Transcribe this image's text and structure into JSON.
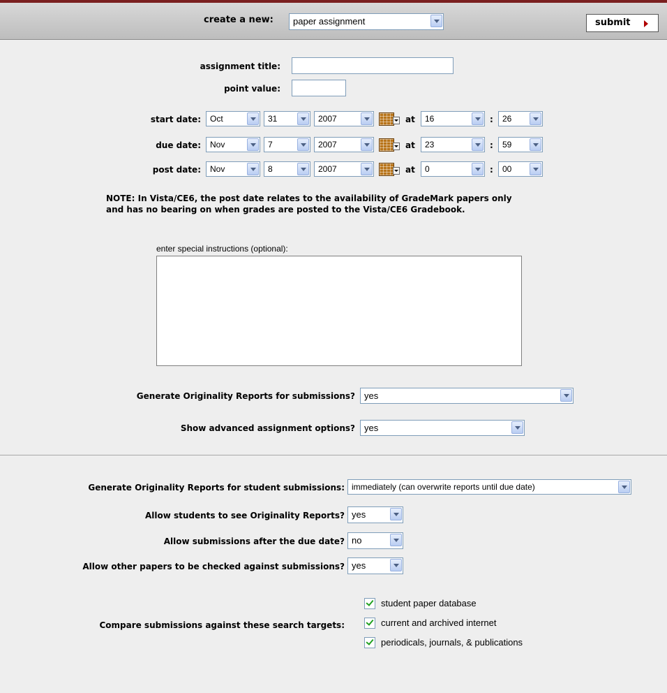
{
  "header": {
    "create_label": "create a new:",
    "create_type": "paper assignment",
    "submit_label": "submit"
  },
  "form": {
    "title_label": "assignment title:",
    "title_value": "",
    "points_label": "point value:",
    "points_value": "",
    "at_label": "at",
    "colon": ":",
    "dates": [
      {
        "label": "start date:",
        "month": "Oct",
        "day": "31",
        "year": "2007",
        "hour": "16",
        "minute": "26"
      },
      {
        "label": "due date:",
        "month": "Nov",
        "day": "7",
        "year": "2007",
        "hour": "23",
        "minute": "59"
      },
      {
        "label": "post date:",
        "month": "Nov",
        "day": "8",
        "year": "2007",
        "hour": "0",
        "minute": "00"
      }
    ],
    "note_line1": "NOTE: In Vista/CE6, the post date relates to the availability of GradeMark papers only",
    "note_line2": "and has no bearing on when grades are posted to the Vista/CE6 Gradebook.",
    "instructions_label": "enter special instructions (optional):",
    "instructions_value": "",
    "originality_label": "Generate Originality Reports for submissions?",
    "originality_value": "yes",
    "advanced_label": "Show advanced assignment options?",
    "advanced_value": "yes"
  },
  "advanced": {
    "gen_reports_label": "Generate Originality Reports for student submissions:",
    "gen_reports_value": "immediately (can overwrite reports until due date)",
    "see_reports_label": "Allow students to see Originality Reports?",
    "see_reports_value": "yes",
    "late_label": "Allow submissions after the due date?",
    "late_value": "no",
    "check_label": "Allow other papers to be checked against submissions?",
    "check_value": "yes",
    "targets_label": "Compare submissions against these search targets:",
    "targets": [
      {
        "label": "student paper database",
        "checked": true
      },
      {
        "label": "current and archived internet",
        "checked": true
      },
      {
        "label": "periodicals, journals, & publications",
        "checked": true
      }
    ]
  }
}
